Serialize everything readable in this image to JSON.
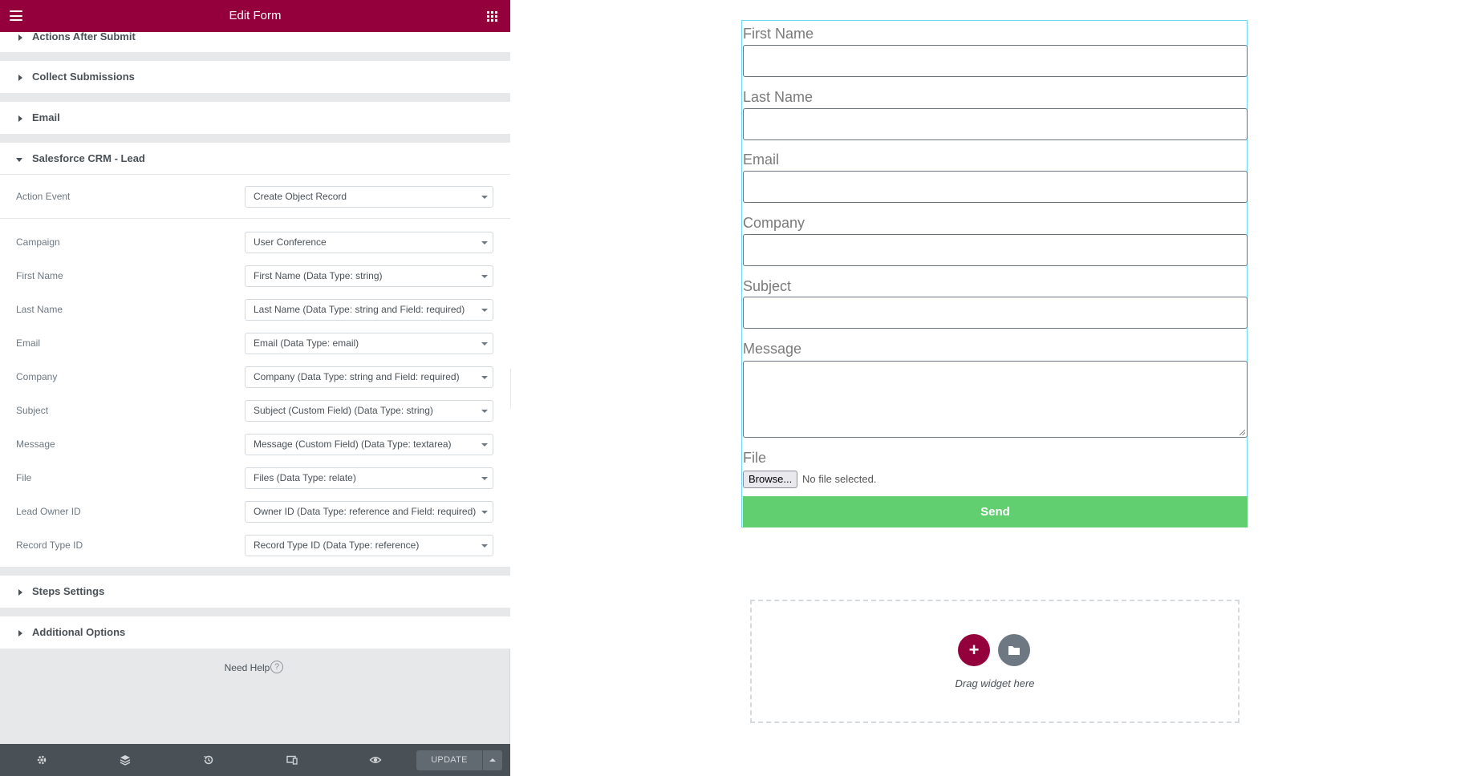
{
  "header": {
    "title": "Edit Form"
  },
  "sections": {
    "actions_after_submit": "Actions After Submit",
    "collect_submissions": "Collect Submissions",
    "email": "Email",
    "salesforce": "Salesforce CRM - Lead",
    "steps_settings": "Steps Settings",
    "additional_options": "Additional Options"
  },
  "salesforce": {
    "action_event": {
      "label": "Action Event",
      "value": "Create Object Record"
    },
    "fields": [
      {
        "label": "Campaign",
        "value": "User Conference"
      },
      {
        "label": "First Name",
        "value": "First Name (Data Type: string)"
      },
      {
        "label": "Last Name",
        "value": "Last Name (Data Type: string and Field: required)"
      },
      {
        "label": "Email",
        "value": "Email (Data Type: email)"
      },
      {
        "label": "Company",
        "value": "Company (Data Type: string and Field: required)"
      },
      {
        "label": "Subject",
        "value": "Subject (Custom Field) (Data Type: string)"
      },
      {
        "label": "Message",
        "value": "Message (Custom Field) (Data Type: textarea)"
      },
      {
        "label": "File",
        "value": "Files (Data Type: relate)"
      },
      {
        "label": "Lead Owner ID",
        "value": "Owner ID (Data Type: reference and Field: required)"
      },
      {
        "label": "Record Type ID",
        "value": "Record Type ID (Data Type: reference)"
      }
    ]
  },
  "help": {
    "text": "Need Help",
    "icon": "?"
  },
  "footer": {
    "update_label": "UPDATE"
  },
  "form": {
    "fields": [
      "First Name",
      "Last Name",
      "Email",
      "Company",
      "Subject",
      "Message",
      "File"
    ],
    "browse_label": "Browse...",
    "no_file_text": "No file selected.",
    "send_label": "Send"
  },
  "drop_zone": {
    "add_icon": "+",
    "text": "Drag widget here"
  },
  "colors": {
    "brand": "#93003c",
    "send": "#61ce70",
    "footer": "#495157"
  }
}
